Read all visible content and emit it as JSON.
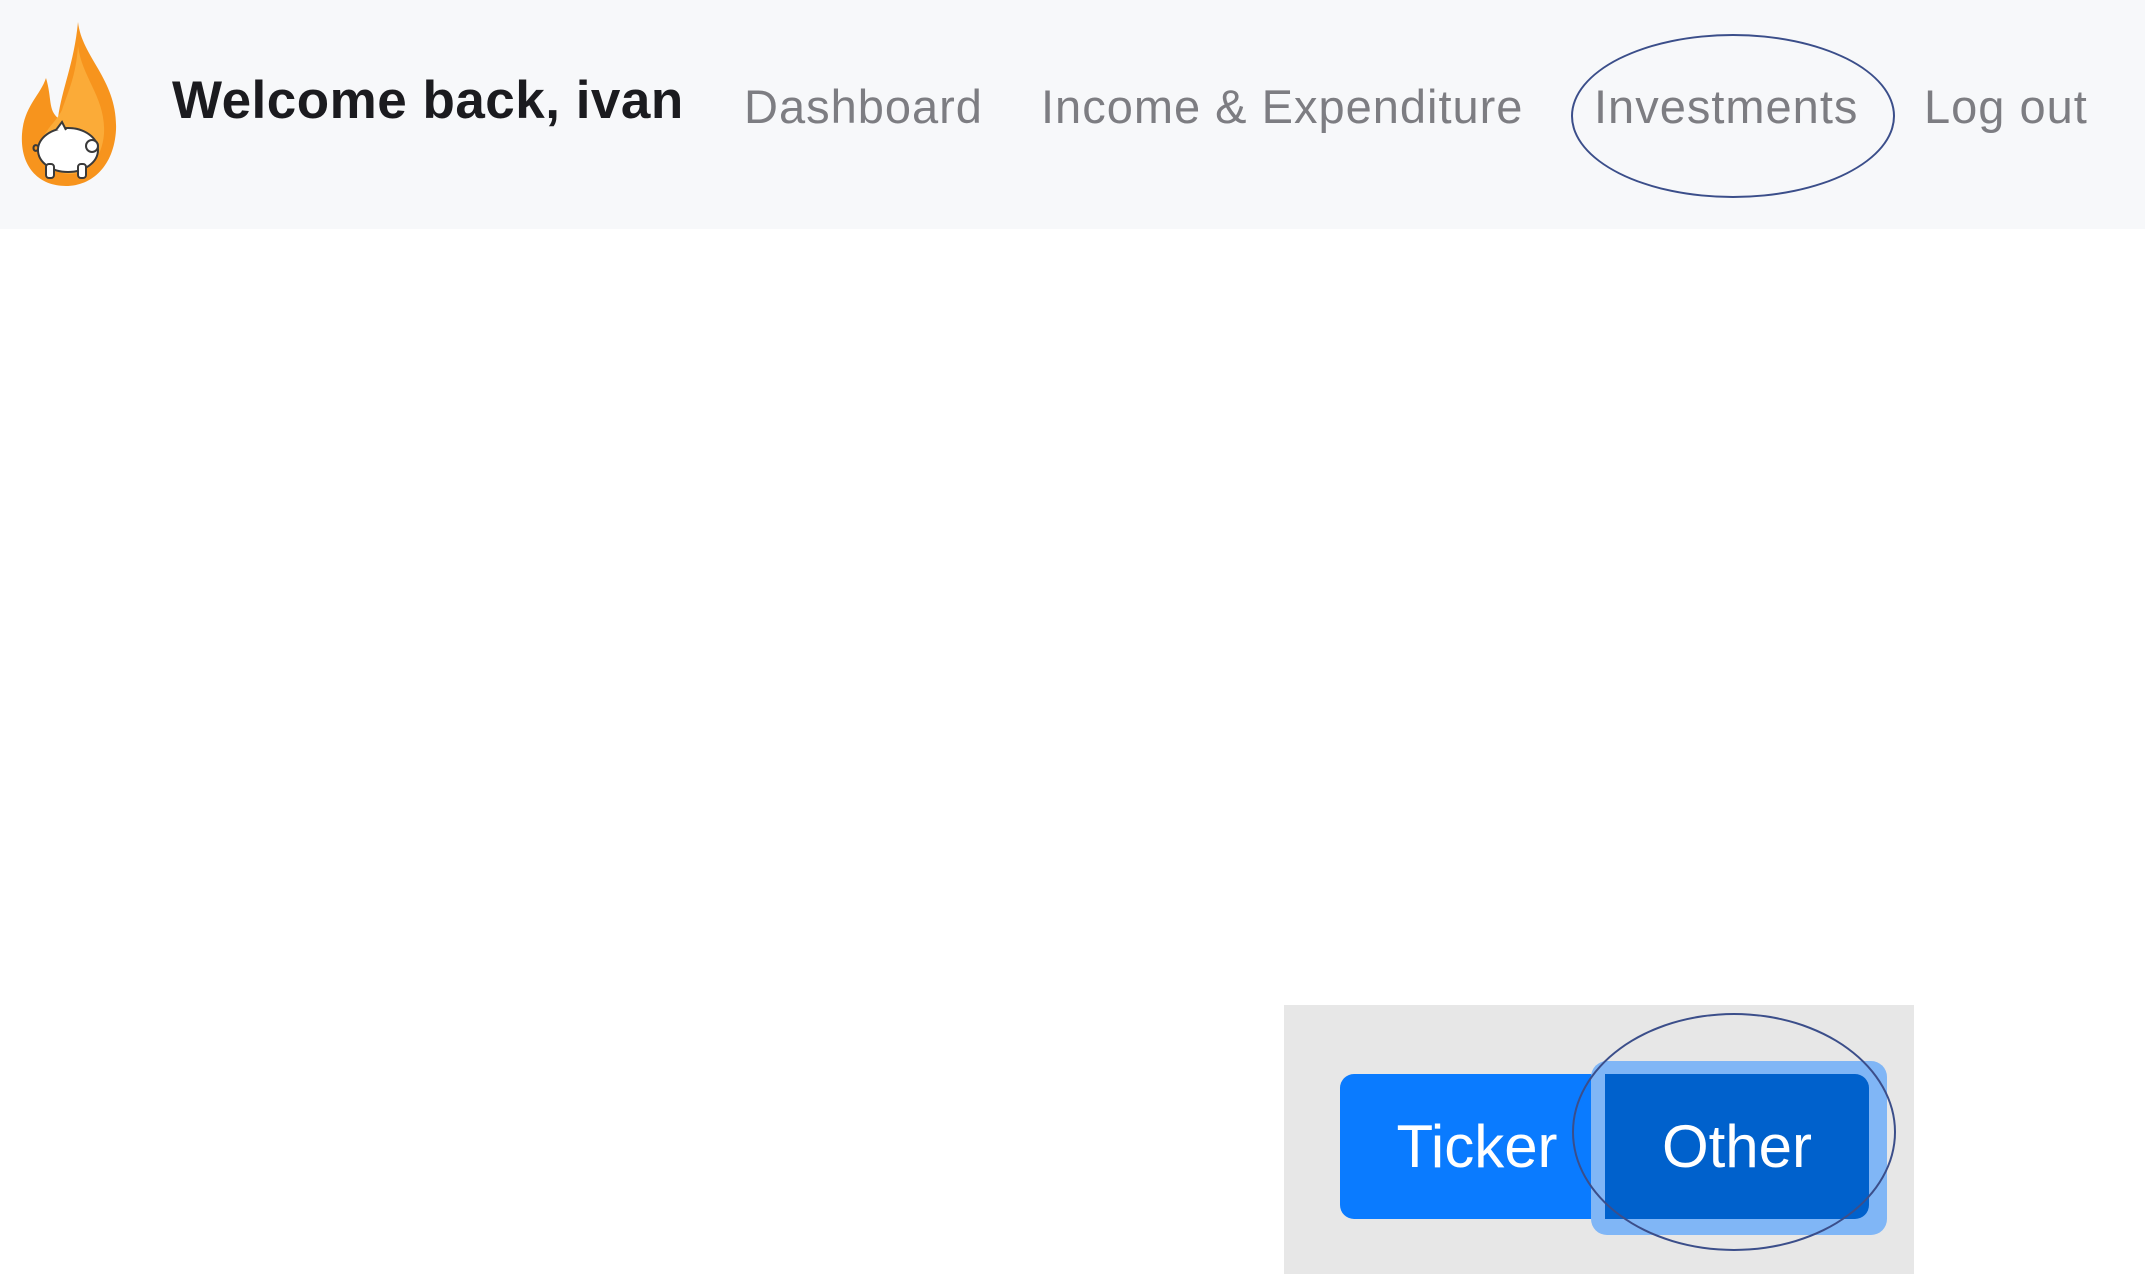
{
  "navbar": {
    "logo_icon": "flame-piggy-bank-icon",
    "welcome_text": "Welcome back, ivan",
    "links": [
      {
        "label": "Dashboard"
      },
      {
        "label": "Income & Expenditure"
      },
      {
        "label": "Investments"
      },
      {
        "label": "Log out"
      }
    ]
  },
  "investment_type_toggle": {
    "options": [
      {
        "label": "Ticker"
      },
      {
        "label": "Other"
      }
    ],
    "selected": "Other"
  },
  "colors": {
    "navbar_bg": "#f7f8fa",
    "primary_button": "#0a7bff",
    "active_button": "#0061cc",
    "focus_ring": "#80b6f6",
    "highlight_ellipse": "#3b4e8a",
    "logo_flame": "#f7941d"
  }
}
